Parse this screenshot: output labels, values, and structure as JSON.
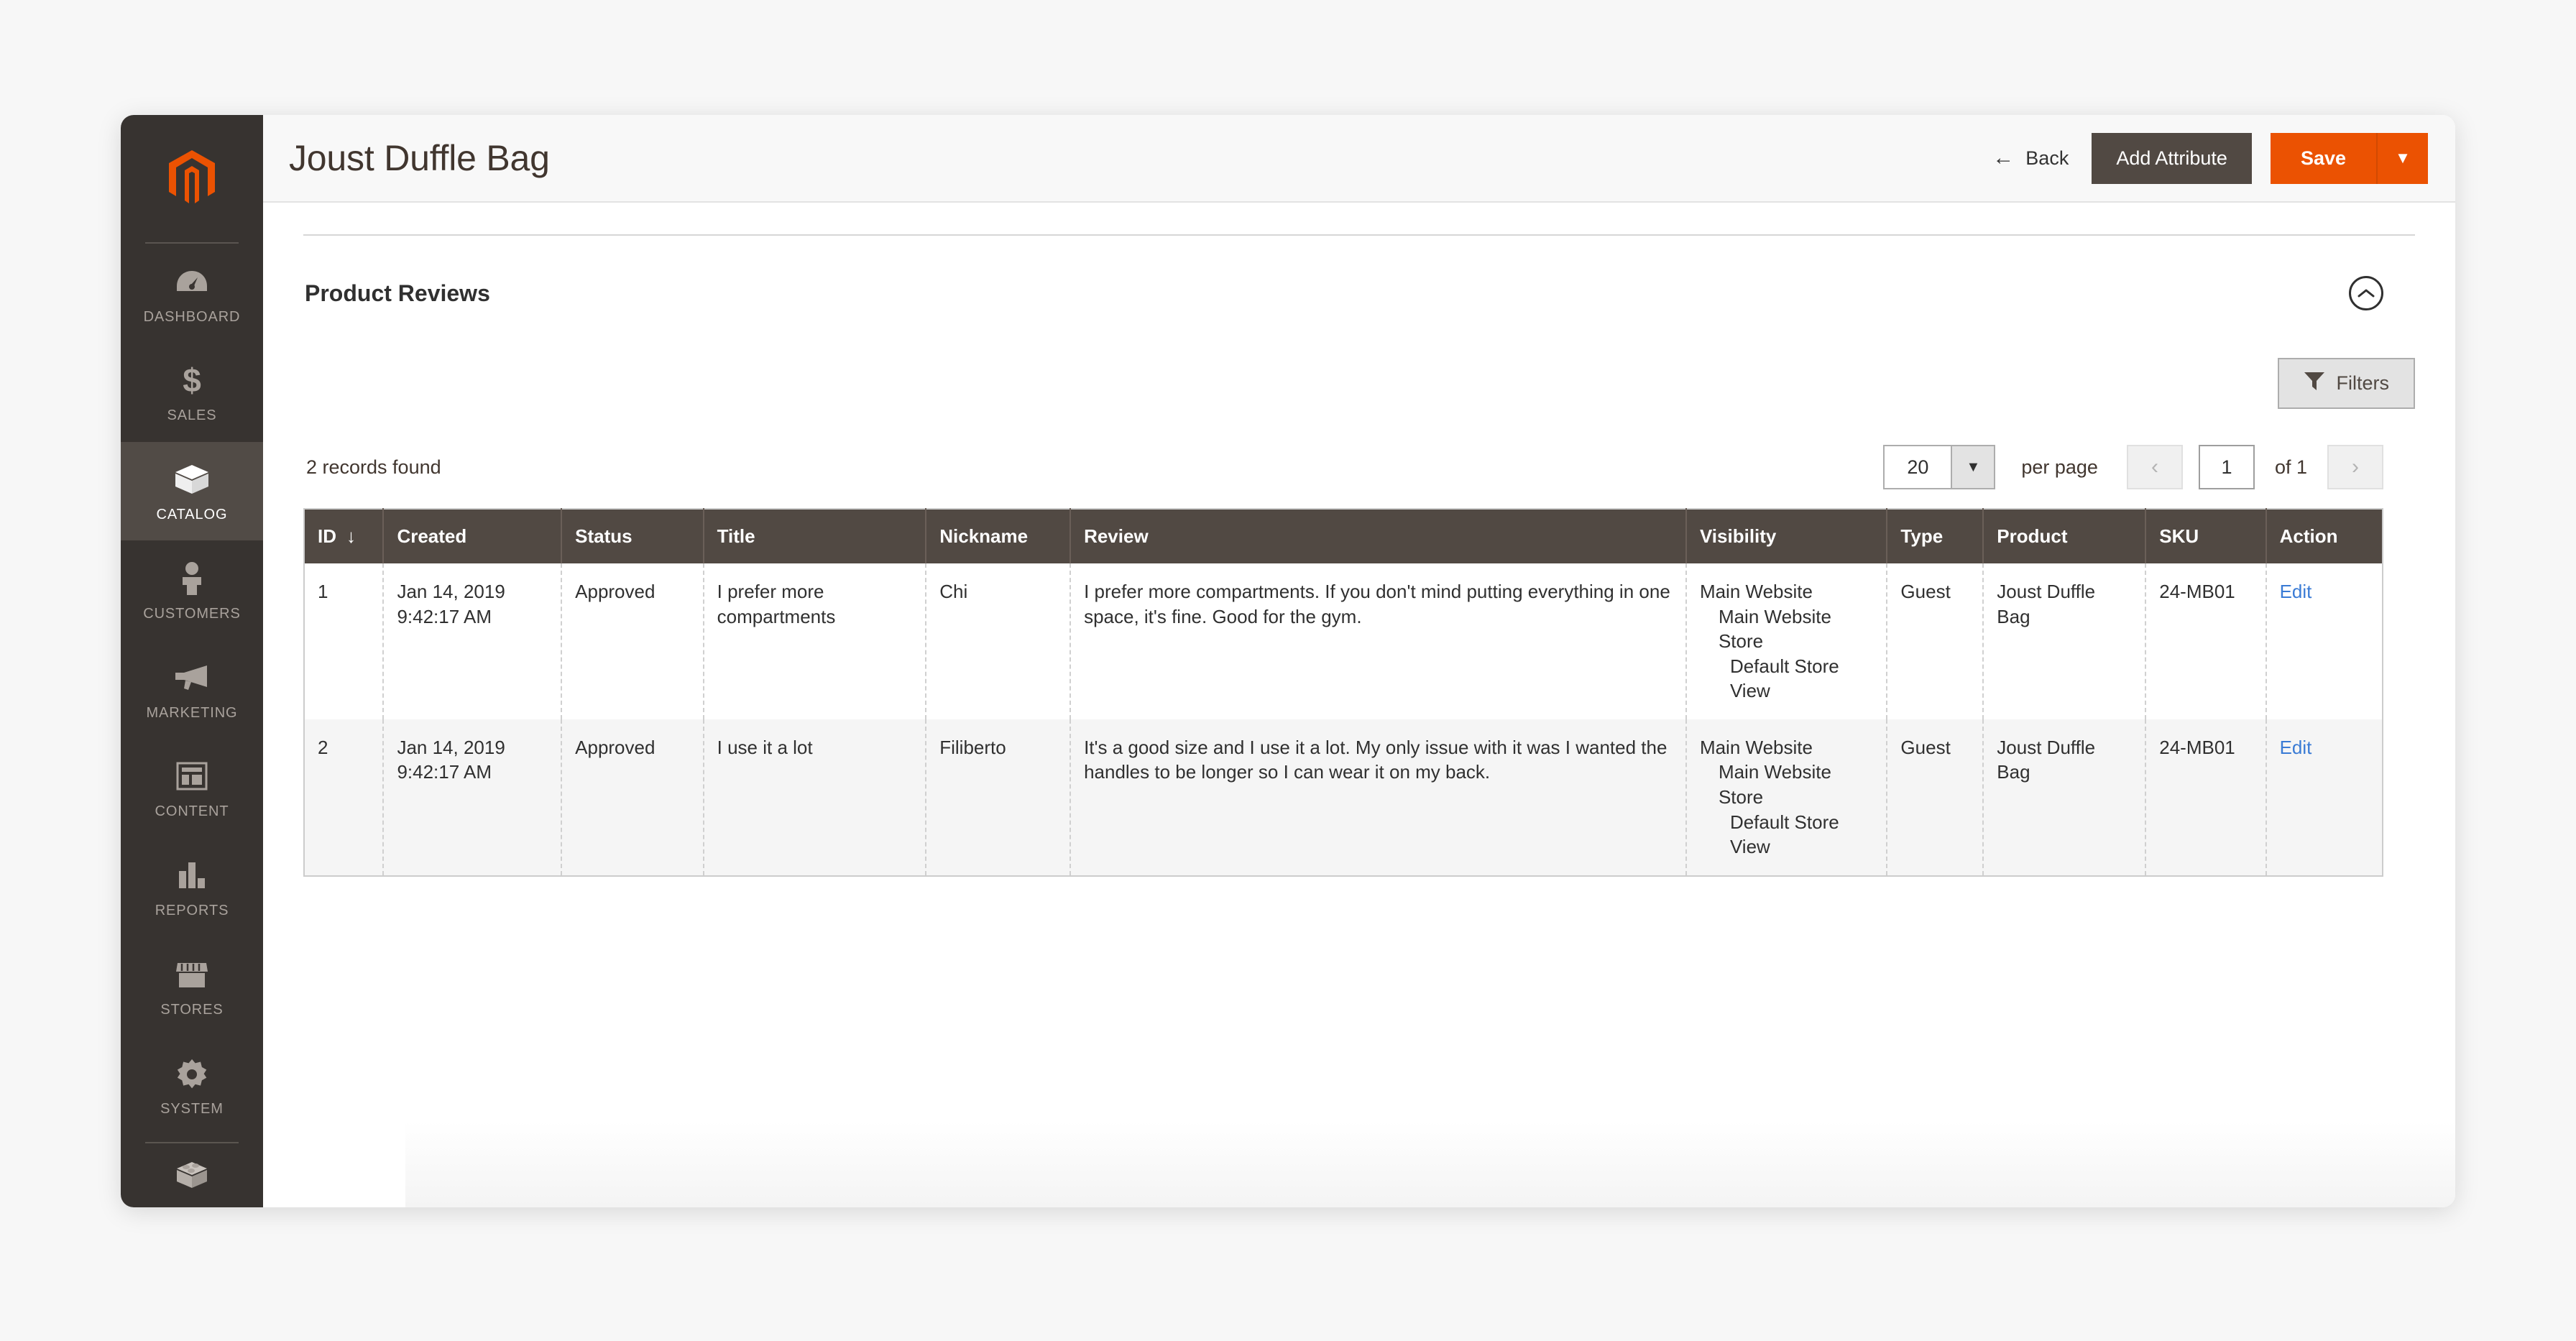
{
  "header": {
    "title": "Joust Duffle Bag",
    "back_label": "Back",
    "back_icon": "arrow-left-icon",
    "add_attribute_label": "Add Attribute",
    "save_label": "Save",
    "save_caret_icon": "caret-down-icon",
    "accent_color": "#eb5202",
    "dark_button_color": "#514943"
  },
  "sidebar": {
    "logo": "magento-logo-icon",
    "items": [
      {
        "label": "Dashboard",
        "icon": "gauge-icon",
        "active": false
      },
      {
        "label": "Sales",
        "icon": "dollar-icon",
        "active": false
      },
      {
        "label": "Catalog",
        "icon": "box-icon",
        "active": true
      },
      {
        "label": "Customers",
        "icon": "person-icon",
        "active": false
      },
      {
        "label": "Marketing",
        "icon": "megaphone-icon",
        "active": false
      },
      {
        "label": "Content",
        "icon": "layout-icon",
        "active": false
      },
      {
        "label": "Reports",
        "icon": "bar-chart-icon",
        "active": false
      },
      {
        "label": "Stores",
        "icon": "storefront-icon",
        "active": false
      },
      {
        "label": "System",
        "icon": "gear-icon",
        "active": false
      },
      {
        "label": "",
        "icon": "extensions-icon",
        "active": false
      }
    ]
  },
  "section": {
    "clipped_text": "",
    "title": "Product Reviews",
    "collapse_icon": "chevron-up-circle-icon"
  },
  "toolbar": {
    "filters_label": "Filters",
    "filters_icon": "funnel-icon"
  },
  "pager": {
    "records_found": "2 records found",
    "per_page_value": "20",
    "per_page_caret": "caret-down-icon",
    "per_page_label": "per page",
    "prev_icon": "chevron-left-icon",
    "next_icon": "chevron-right-icon",
    "current_page": "1",
    "of_label": "of 1"
  },
  "grid": {
    "columns": [
      {
        "label": "ID",
        "sort": "↓"
      },
      {
        "label": "Created",
        "sort": ""
      },
      {
        "label": "Status",
        "sort": ""
      },
      {
        "label": "Title",
        "sort": ""
      },
      {
        "label": "Nickname",
        "sort": ""
      },
      {
        "label": "Review",
        "sort": ""
      },
      {
        "label": "Visibility",
        "sort": ""
      },
      {
        "label": "Type",
        "sort": ""
      },
      {
        "label": "Product",
        "sort": ""
      },
      {
        "label": "SKU",
        "sort": ""
      },
      {
        "label": "Action",
        "sort": ""
      }
    ],
    "rows": [
      {
        "id": "1",
        "created_date": "Jan 14, 2019",
        "created_time": "9:42:17 AM",
        "status": "Approved",
        "title": "I prefer more compartments",
        "nickname": "Chi",
        "review": "I prefer more compartments. If you don't mind putting everything in one space, it's fine. Good for the gym.",
        "visibility_website": "Main Website",
        "visibility_store": "Main Website Store",
        "visibility_view": "Default Store View",
        "type": "Guest",
        "product": "Joust Duffle Bag",
        "sku": "24-MB01",
        "action": "Edit"
      },
      {
        "id": "2",
        "created_date": "Jan 14, 2019",
        "created_time": "9:42:17 AM",
        "status": "Approved",
        "title": "I use it a lot",
        "nickname": "Filiberto",
        "review": "It's a good size and I use it a lot. My only issue with it was I wanted the handles to be longer so I can wear it on my back.",
        "visibility_website": "Main Website",
        "visibility_store": "Main Website Store",
        "visibility_view": "Default Store View",
        "type": "Guest",
        "product": "Joust Duffle Bag",
        "sku": "24-MB01",
        "action": "Edit"
      }
    ]
  }
}
